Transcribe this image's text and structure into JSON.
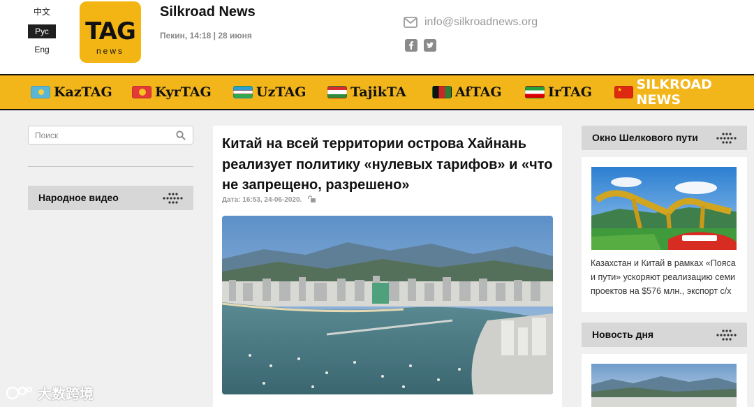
{
  "languages": [
    {
      "label": "中文",
      "active": false
    },
    {
      "label": "Рус",
      "active": true
    },
    {
      "label": "Eng",
      "active": false
    }
  ],
  "logo": {
    "main": "TAG",
    "sub": "news",
    "color": "#f3b514"
  },
  "site": {
    "title": "Silkroad News",
    "date": "Пекин, 14:18 | 28 июня"
  },
  "contact": {
    "email": "info@silkroadnews.org",
    "icon": "mail-icon"
  },
  "social": [
    {
      "name": "facebook",
      "icon": "facebook-icon"
    },
    {
      "name": "twitter",
      "icon": "twitter-icon"
    }
  ],
  "nav": [
    {
      "label": "KazTAG",
      "flag": "kazakhstan-flag"
    },
    {
      "label": "KyrTAG",
      "flag": "kyrgyzstan-flag"
    },
    {
      "label": "UzTAG",
      "flag": "uzbekistan-flag"
    },
    {
      "label": "TajikTA",
      "flag": "tajikistan-flag"
    },
    {
      "label": "AfTAG",
      "flag": "afghanistan-flag"
    },
    {
      "label": "IrTAG",
      "flag": "iran-flag"
    },
    {
      "label": "SILKROAD NEWS",
      "flag": "china-flag",
      "highlight": true
    }
  ],
  "nav_color": "#f2b61a",
  "search": {
    "placeholder": "Поиск",
    "icon": "search-icon"
  },
  "left_sections": {
    "video": "Народное видео"
  },
  "article": {
    "title": "Китай на всей территории острова Хайнань реализует политику «нулевых тарифов» и «что не запрещено, разрешено»",
    "date": "Дата: 16:53, 24-06-2020."
  },
  "right": {
    "window_title": "Окно Шелкового пути",
    "card_text": "Казахстан и Китай в рамках «Пояса и пути» ускоряют реализацию семи проектов на $576 млн., экспорт с/х",
    "news_title": "Новость дня"
  },
  "watermark": "大数跨境"
}
